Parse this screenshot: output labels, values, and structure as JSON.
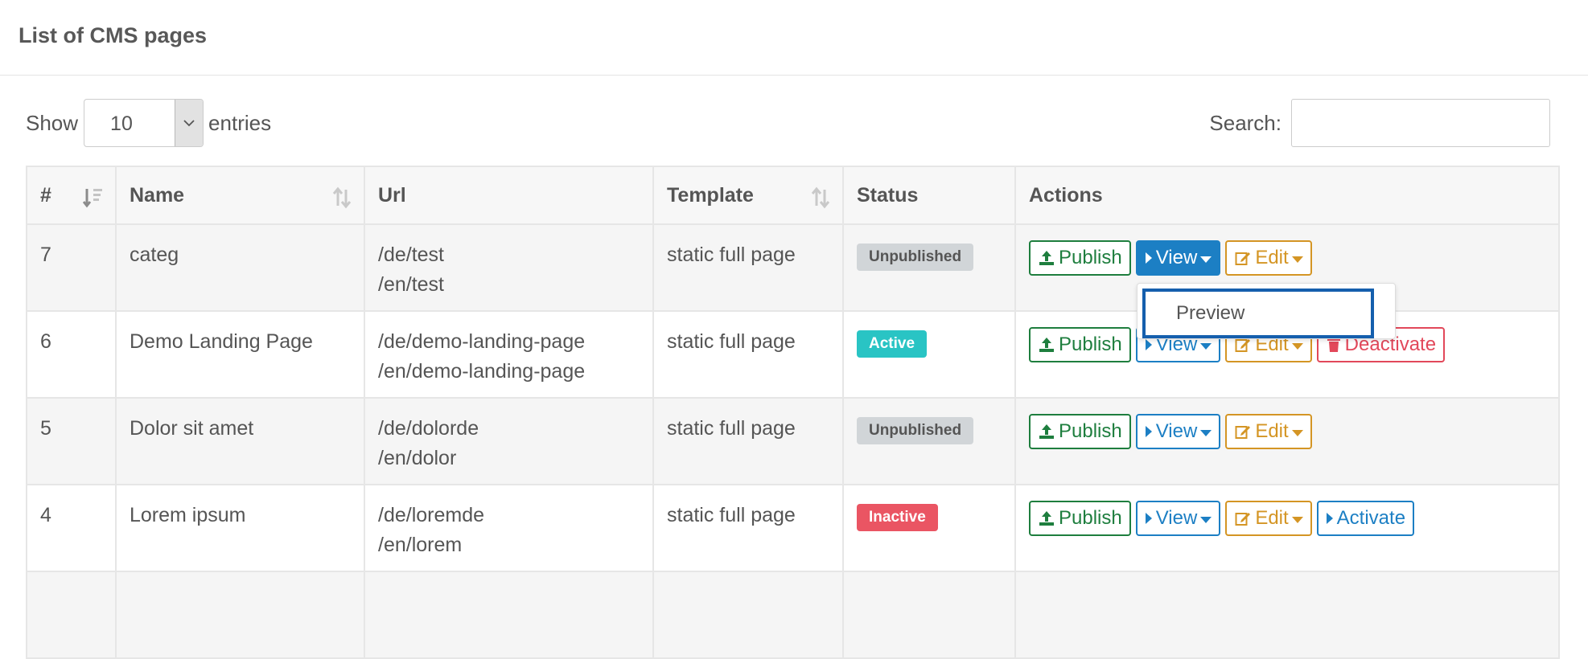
{
  "header": {
    "title": "List of CMS pages"
  },
  "length_menu": {
    "show_label": "Show",
    "value": "10",
    "entries_label": "entries"
  },
  "search": {
    "label": "Search:",
    "value": ""
  },
  "table": {
    "columns": [
      "#",
      "Name",
      "Url",
      "Template",
      "Status",
      "Actions"
    ],
    "rows": [
      {
        "id": "7",
        "name": "categ",
        "url_de": "/de/test",
        "url_en": "/en/test",
        "template": "static full page",
        "status": "Unpublished",
        "status_type": "unpublished",
        "extra_action": ""
      },
      {
        "id": "6",
        "name": "Demo Landing Page",
        "url_de": "/de/demo-landing-page",
        "url_en": "/en/demo-landing-page",
        "template": "static full page",
        "status": "Active",
        "status_type": "active",
        "extra_action": "Deactivate"
      },
      {
        "id": "5",
        "name": "Dolor sit amet",
        "url_de": "/de/dolorde",
        "url_en": "/en/dolor",
        "template": "static full page",
        "status": "Unpublished",
        "status_type": "unpublished",
        "extra_action": ""
      },
      {
        "id": "4",
        "name": "Lorem ipsum",
        "url_de": "/de/loremde",
        "url_en": "/en/lorem",
        "template": "static full page",
        "status": "Inactive",
        "status_type": "inactive",
        "extra_action": "Activate"
      }
    ]
  },
  "actions": {
    "publish": "Publish",
    "view": "View",
    "edit": "Edit"
  },
  "dropdown": {
    "item": "Preview"
  },
  "colors": {
    "publish": "#1e7e3e",
    "view": "#1c7fc4",
    "edit": "#d49524",
    "deactivate": "#e2485a",
    "active_badge": "#29c4c4",
    "inactive_badge": "#ea5563",
    "unpublished_badge": "#d1d5d8",
    "focus_ring": "#155fad"
  }
}
